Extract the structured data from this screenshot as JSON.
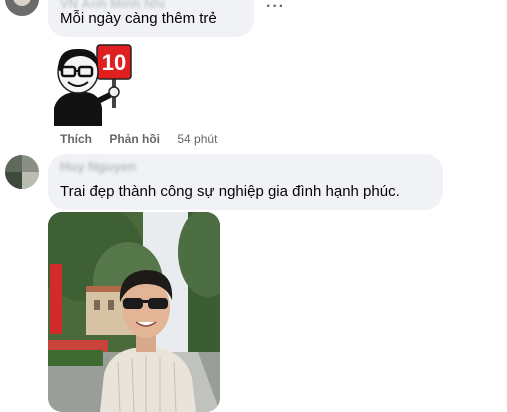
{
  "comment1": {
    "author": "VN Anh Minh Nhi",
    "text": "Mỗi ngày càng thêm trẻ",
    "more_icon": "more-horizontal-icon",
    "sticker": {
      "sign_number": "10"
    }
  },
  "actions": {
    "like_label": "Thích",
    "reply_label": "Phản hồi",
    "time": "54 phút"
  },
  "comment2": {
    "author": "Huy Nguyen",
    "text": "Trai đẹp thành công sự nghiệp gia đình hạnh phúc.",
    "photo": {
      "subject": "man-with-sunglasses-photo"
    }
  }
}
